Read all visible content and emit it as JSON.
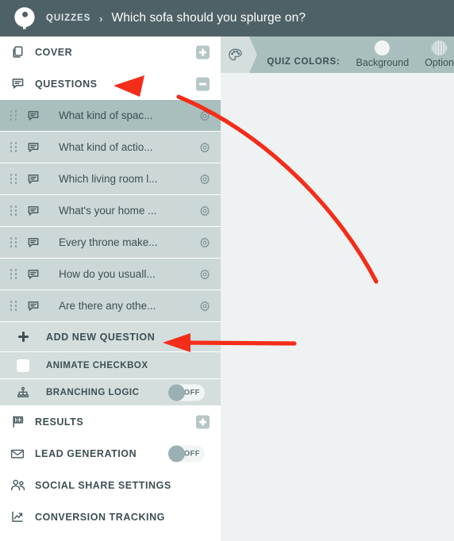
{
  "header": {
    "logo_icon": "interact-logo-icon",
    "breadcrumb_root": "QUIZZES",
    "breadcrumb_separator": "›",
    "breadcrumb_current": "Which sofa should you splurge on?",
    "background_color": "#4e6166"
  },
  "color_bar": {
    "palette_icon": "palette-icon",
    "title": "QUIZ COLORS:",
    "swatches": [
      {
        "label": "Background",
        "color": "#f2f4f4",
        "kind": "solid"
      },
      {
        "label": "Option",
        "color": "#cdd9d9",
        "kind": "pattern"
      }
    ],
    "background_color": "#a9bfbd"
  },
  "sidebar": {
    "cover": {
      "label": "COVER",
      "icon": "copy-pages-icon",
      "action_icon": "plus-square-icon"
    },
    "questions_header": {
      "label": "QUESTIONS",
      "icon": "speech-bubble-icon",
      "action_icon": "minus-square-icon",
      "expanded": true
    },
    "questions": [
      {
        "label": "What kind of spac...",
        "icon": "speech-bubble-icon",
        "settings_icon": "gear-icon",
        "selected": true
      },
      {
        "label": "What kind of actio...",
        "icon": "speech-bubble-icon",
        "settings_icon": "gear-icon",
        "selected": false
      },
      {
        "label": "Which living room l...",
        "icon": "speech-bubble-icon",
        "settings_icon": "gear-icon",
        "selected": false
      },
      {
        "label": "What's your home ...",
        "icon": "speech-bubble-icon",
        "settings_icon": "gear-icon",
        "selected": false
      },
      {
        "label": "Every throne make...",
        "icon": "speech-bubble-icon",
        "settings_icon": "gear-icon",
        "selected": false
      },
      {
        "label": "How do you usuall...",
        "icon": "speech-bubble-icon",
        "settings_icon": "gear-icon",
        "selected": false
      },
      {
        "label": "Are there any othe...",
        "icon": "speech-bubble-icon",
        "settings_icon": "gear-icon",
        "selected": false
      }
    ],
    "add_question": {
      "label": "ADD NEW QUESTION",
      "icon": "plus-icon"
    },
    "animate_checkbox": {
      "label": "ANIMATE CHECKBOX",
      "checked": false
    },
    "branching_logic": {
      "label": "BRANCHING LOGIC",
      "icon": "sitemap-icon",
      "toggle_state": "OFF"
    },
    "results": {
      "label": "RESULTS",
      "icon": "checkered-flag-icon",
      "action_icon": "plus-square-icon"
    },
    "lead_generation": {
      "label": "LEAD GENERATION",
      "icon": "envelope-icon",
      "toggle_state": "OFF"
    },
    "social_share": {
      "label": "SOCIAL SHARE SETTINGS",
      "icon": "people-icon"
    },
    "conversion_tracking": {
      "label": "CONVERSION TRACKING",
      "icon": "line-chart-icon"
    }
  },
  "annotations": {
    "arrow_color": "#f42d1a",
    "arrows": [
      {
        "name": "curved-arrow-to-questions",
        "shape": "curved"
      },
      {
        "name": "straight-arrow-to-add-question",
        "shape": "straight"
      }
    ]
  }
}
